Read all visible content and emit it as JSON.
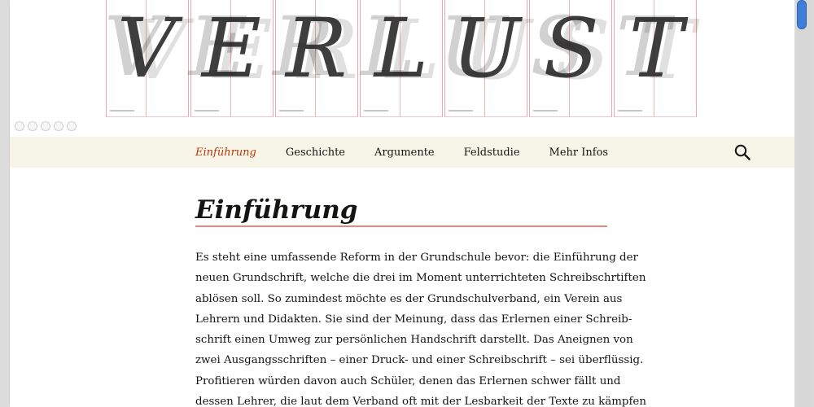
{
  "header": {
    "banner_letters": [
      "V",
      "E",
      "R",
      "L",
      "U",
      "S",
      "T"
    ],
    "slider_dots_count": 5
  },
  "nav": {
    "items": [
      {
        "label": "Einführung",
        "active": true
      },
      {
        "label": "Geschichte",
        "active": false
      },
      {
        "label": "Argumente",
        "active": false
      },
      {
        "label": "Feldstudie",
        "active": false
      },
      {
        "label": "Mehr Infos",
        "active": false
      }
    ],
    "search_icon": "search-icon"
  },
  "article": {
    "title": "Einführung",
    "lines": [
      "Es steht eine umfassende Reform in der Grundschule bevor: die Einführung der",
      "neuen Grundschrift, welche die drei im Moment unterrichteten Schreibschrtiften",
      "ablösen soll. So zumindest möchte es der Grundschulverband, ein Verein aus",
      "Lehrern und Didakten. Sie sind der Meinung, dass das Erlernen einer Schreib-",
      "schrift einen Umweg zur persönlichen Handschrift darstellt. Das Aneignen von",
      "zwei Ausgangsschriften – einer Druck- und einer Schreibschrift – sei überflüssig.",
      "Profitieren würden davon auch Schüler, denen das Erlernen schwer fällt und",
      "dessen Lehrer, die laut dem Verband oft mit der Lesbarkeit der Texte zu kämpfen"
    ]
  },
  "colors": {
    "nav_bg": "#f7f5e7",
    "accent": "#bc360a",
    "title_rule": "#e48a7a",
    "scroll_thumb": "#3f7ed9"
  }
}
